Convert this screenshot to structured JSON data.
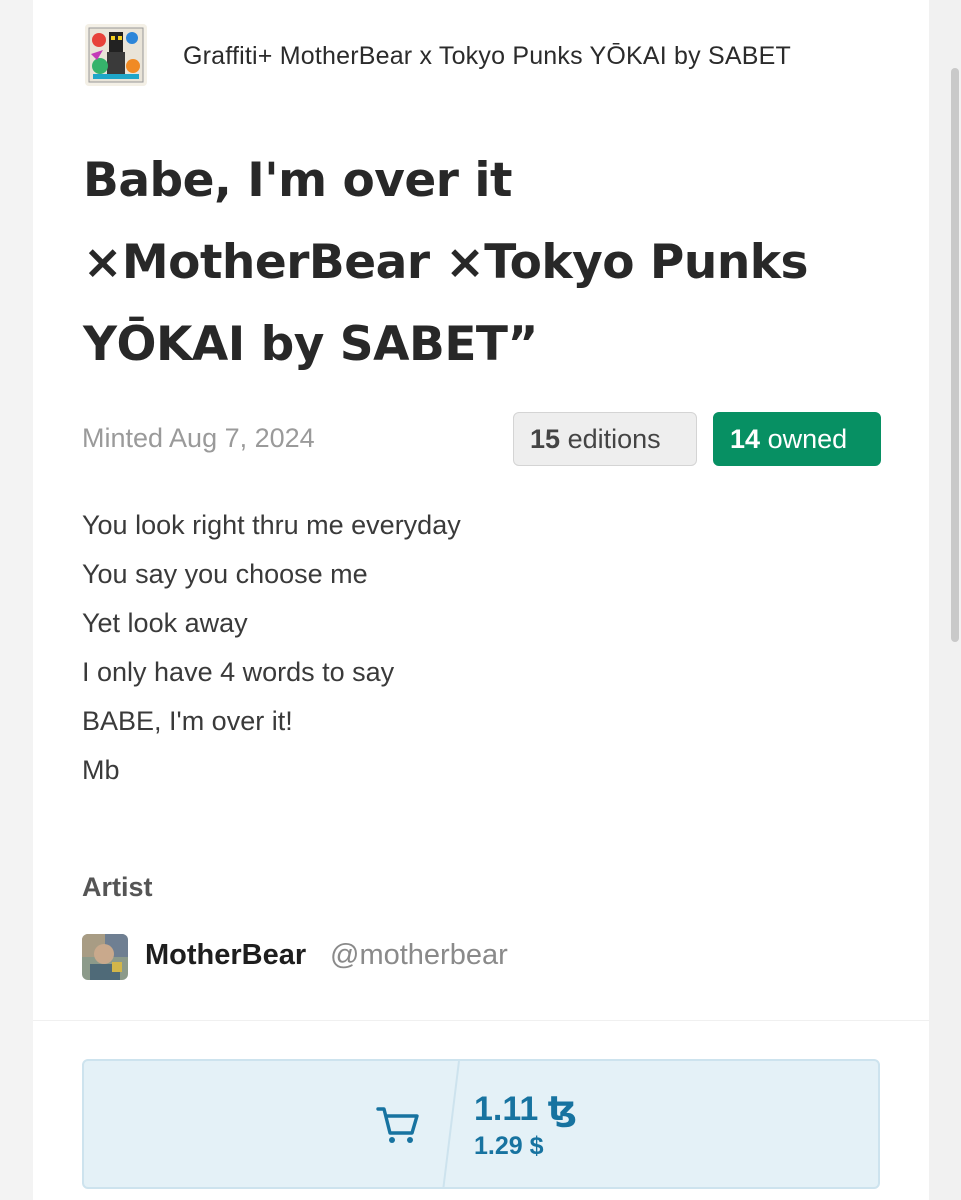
{
  "collection": {
    "name": "Graffiti+ MotherBear x Tokyo Punks YŌKAI by SABET",
    "thumbnail_icon": "collection-artwork-thumbnail"
  },
  "token": {
    "title_lines": [
      "Babe, I'm over it",
      "×MotherBear ×Tokyo Punks",
      "YŌKAI by SABET”"
    ],
    "minted": "Minted Aug 7, 2024",
    "editions_count": "15",
    "editions_label": "editions",
    "owned_count": "14",
    "owned_label": "owned"
  },
  "description": [
    "You look right thru me everyday",
    "You say you choose me",
    "Yet look away",
    "I only have 4 words to say",
    "BABE, I'm over it!",
    "Mb"
  ],
  "artist": {
    "label": "Artist",
    "name": "MotherBear",
    "handle": "@motherbear",
    "avatar_icon": "artist-avatar-image"
  },
  "purchase": {
    "cart_icon": "shopping-cart-icon",
    "price": "1.11 ꜩ",
    "price_usd": "1.29 $"
  },
  "colors": {
    "owned_badge": "#079063",
    "price_text": "#1773a0",
    "buy_box_bg": "#e4f1f7"
  }
}
